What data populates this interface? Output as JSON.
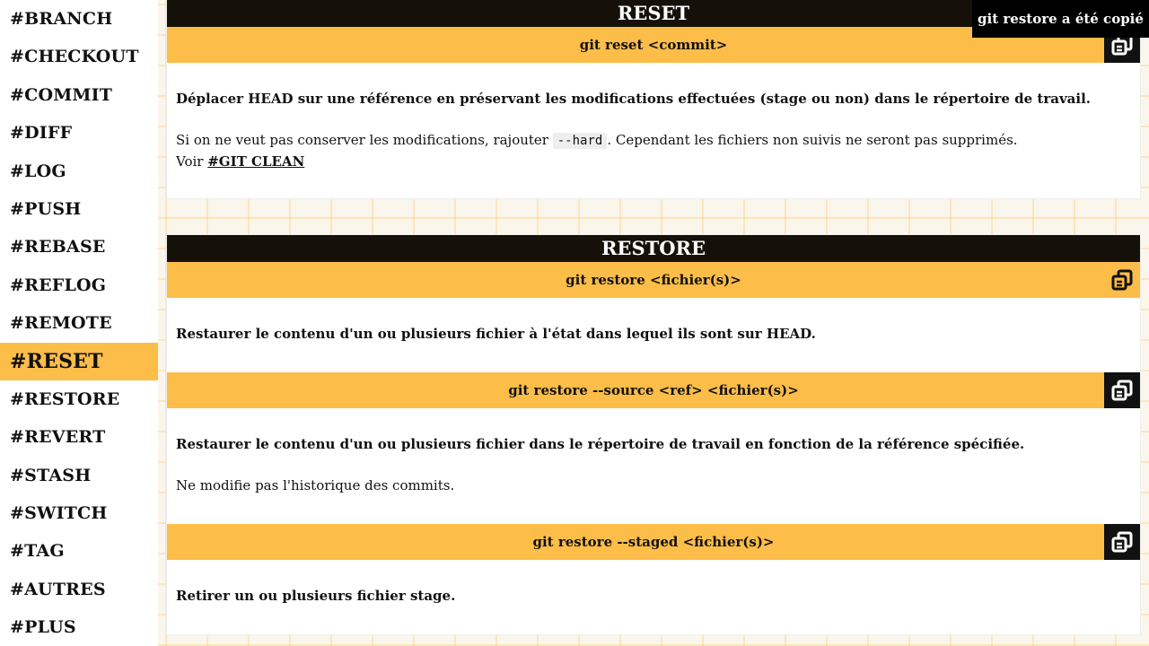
{
  "sidebar": {
    "items": [
      {
        "label": "#BRANCH"
      },
      {
        "label": "#CHECKOUT"
      },
      {
        "label": "#COMMIT"
      },
      {
        "label": "#DIFF"
      },
      {
        "label": "#LOG"
      },
      {
        "label": "#PUSH"
      },
      {
        "label": "#REBASE"
      },
      {
        "label": "#REFLOG"
      },
      {
        "label": "#REMOTE"
      },
      {
        "label": "#RESET"
      },
      {
        "label": "#RESTORE"
      },
      {
        "label": "#REVERT"
      },
      {
        "label": "#STASH"
      },
      {
        "label": "#SWITCH"
      },
      {
        "label": "#TAG"
      },
      {
        "label": "#AUTRES"
      },
      {
        "label": "#PLUS"
      }
    ],
    "active": "#RESET"
  },
  "reset": {
    "title": "RESET",
    "commands": [
      {
        "cmd": "git reset <commit>",
        "desc_bold": "Déplacer HEAD sur une référence en préservant les modifications effectuées (stage ou non) dans le répertoire de travail.",
        "desc_pre": "Si on ne veut pas conserver les modifications, rajouter ",
        "code": "--hard",
        "desc_post": ". Cependant les fichiers non suivis ne seront pas supprimés.",
        "voir": "Voir ",
        "link": "#GIT CLEAN"
      }
    ]
  },
  "restore": {
    "title": "RESTORE",
    "commands": [
      {
        "cmd": "git restore <fichier(s)>",
        "desc_bold": "Restaurer le contenu d'un ou plusieurs fichier à l'état dans lequel ils sont sur HEAD."
      },
      {
        "cmd": "git restore --source <ref> <fichier(s)>",
        "desc_bold": "Restaurer le contenu d'un ou plusieurs fichier dans le répertoire de travail en fonction de la référence spécifiée.",
        "desc_normal": "Ne modifie pas l'historique des commits."
      },
      {
        "cmd": "git restore --staged <fichier(s)>",
        "desc_bold": "Retirer un ou plusieurs fichier stage."
      }
    ]
  },
  "toast": {
    "message": "git restore a été copié"
  },
  "colors": {
    "accent": "#fdbd49",
    "dark": "#151109"
  }
}
